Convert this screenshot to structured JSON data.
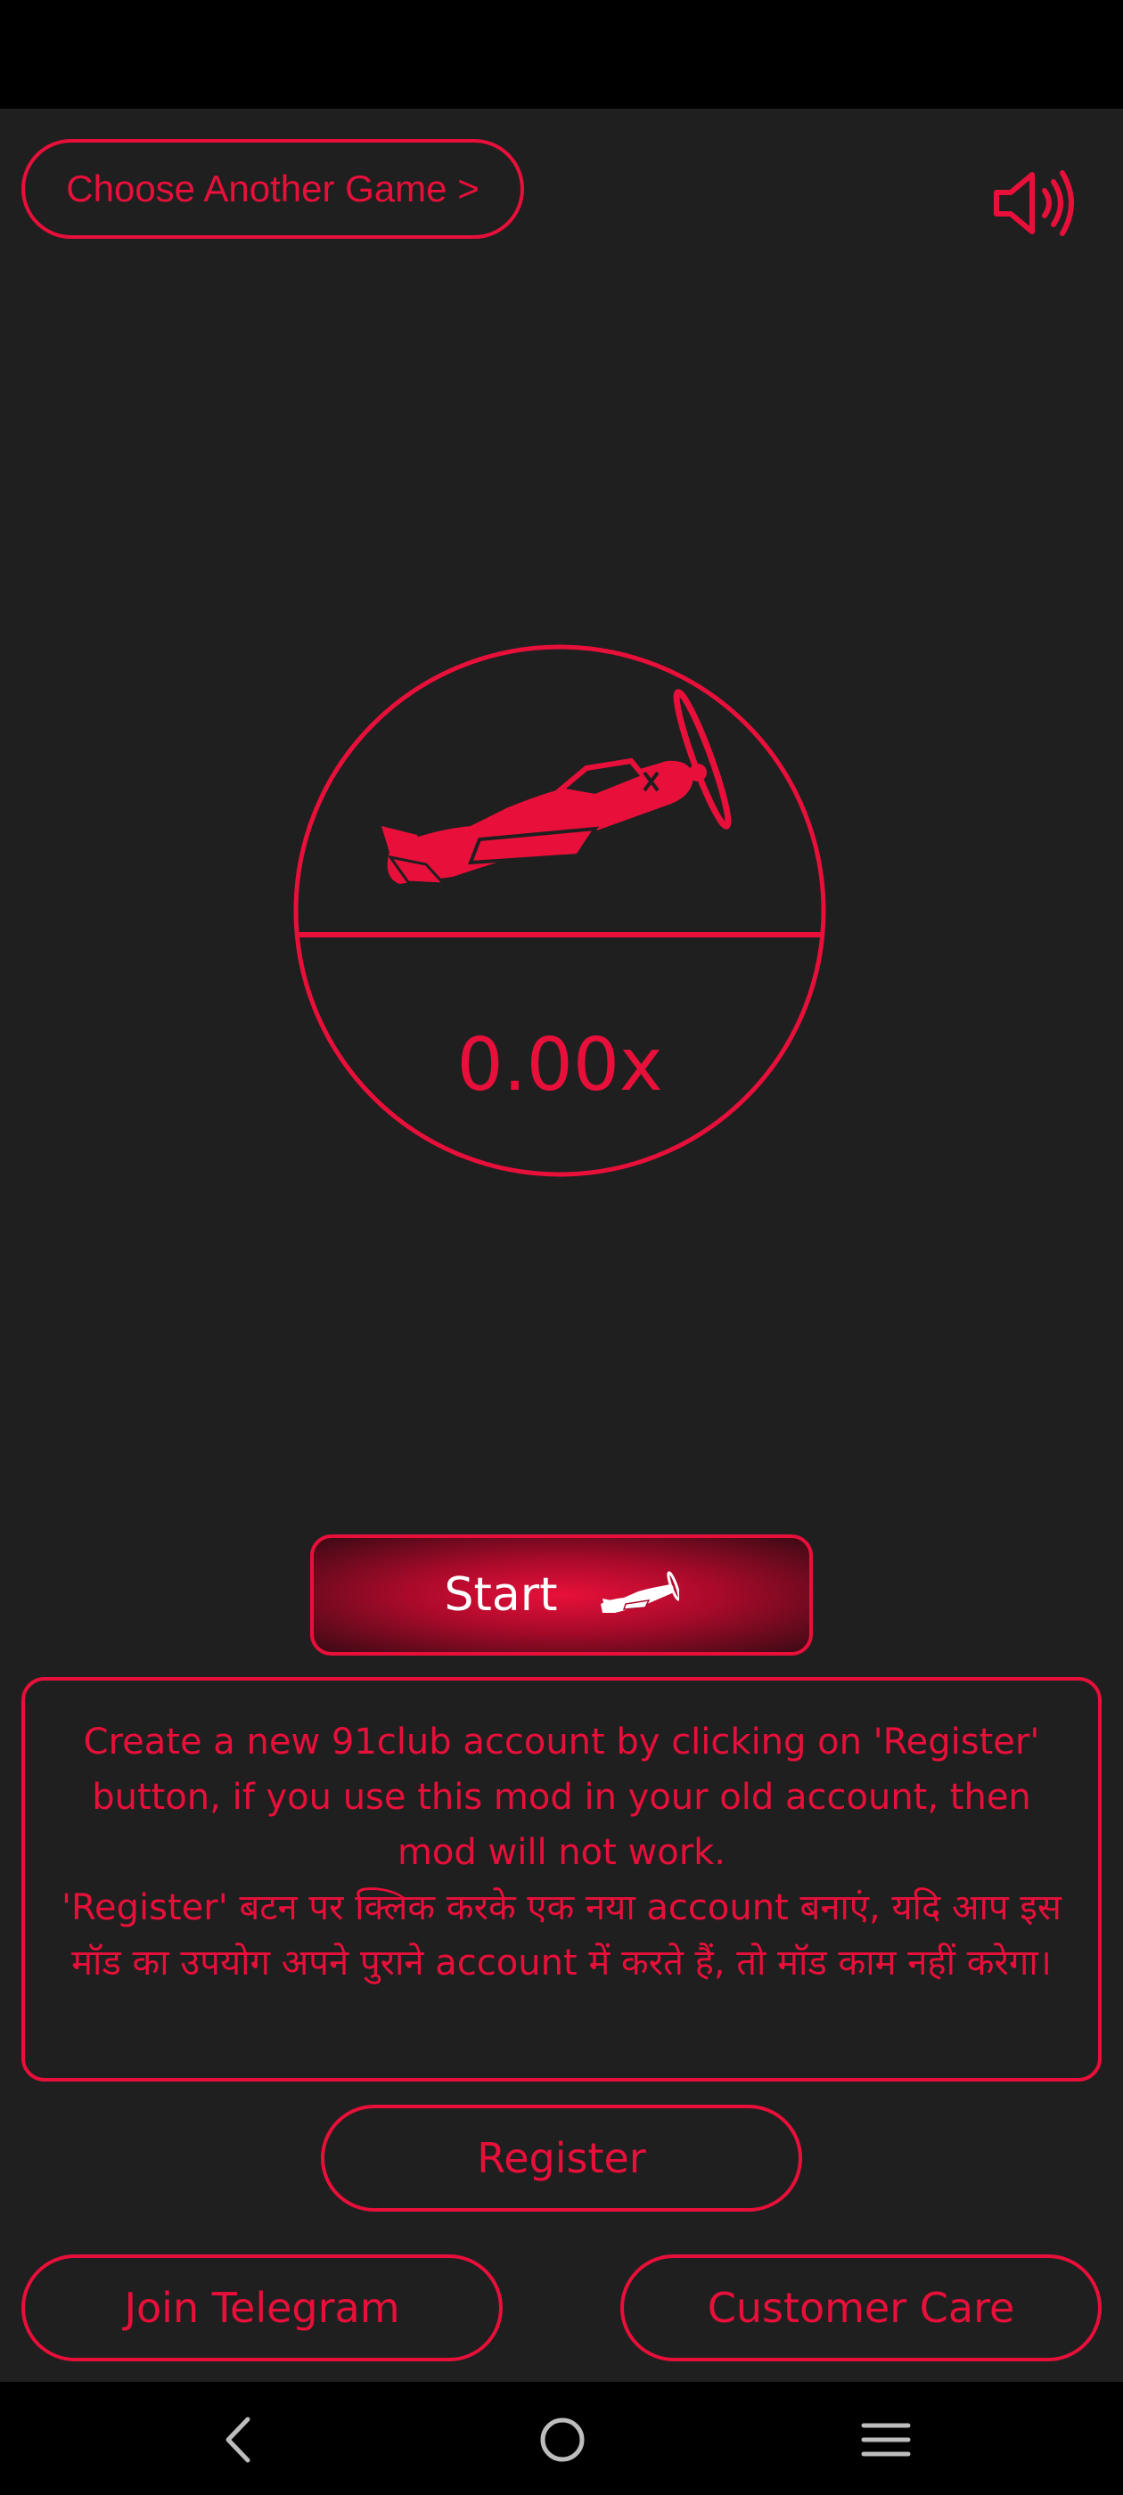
{
  "header": {
    "choose_game_label": "Choose Another Game >",
    "sound_icon": "speaker-volume-icon"
  },
  "game": {
    "multiplier": "0.00x",
    "plane_icon": "airplane-icon"
  },
  "start_button": {
    "label": "Start",
    "icon": "airplane-icon"
  },
  "notice": {
    "english": "Create a new 91club account by clicking on 'Register' button, if you use this mod in your old account, then mod will not work.",
    "hindi": "'Register' बटन पर क्लिक करके एक नया account बनाएं, यदि आप इस मॉड का उपयोग अपने पुराने account में करते हैं, तो मॉड काम नहीं करेगा।"
  },
  "buttons": {
    "register": "Register",
    "join_telegram": "Join Telegram",
    "customer_care": "Customer Care"
  },
  "nav": {
    "back_icon": "back-chevron-icon",
    "home_icon": "home-circle-icon",
    "menu_icon": "menu-lines-icon"
  },
  "colors": {
    "accent": "#e8103a",
    "background": "#1f1f1f",
    "bars": "#000000"
  }
}
